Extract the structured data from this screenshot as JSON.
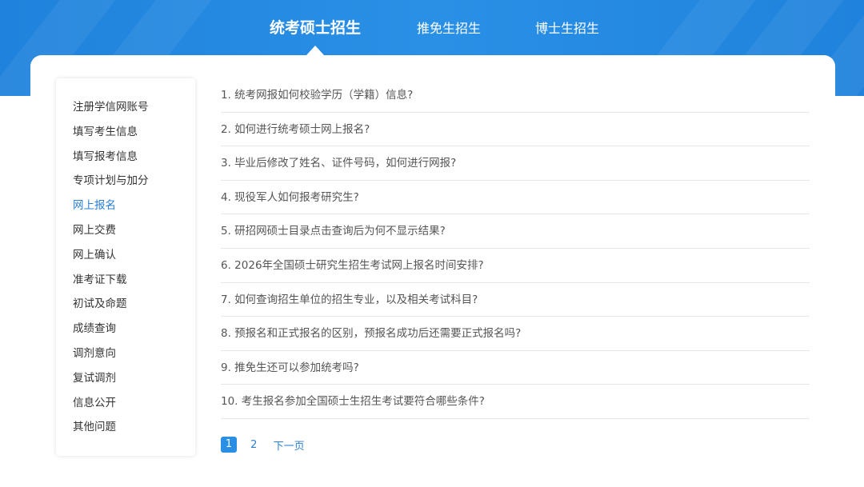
{
  "tabs": [
    {
      "label": "统考硕士招生",
      "active": true
    },
    {
      "label": "推免生招生",
      "active": false
    },
    {
      "label": "博士生招生",
      "active": false
    }
  ],
  "sidebar": {
    "items": [
      {
        "label": "注册学信网账号"
      },
      {
        "label": "填写考生信息"
      },
      {
        "label": "填写报考信息"
      },
      {
        "label": "专项计划与加分"
      },
      {
        "label": "网上报名",
        "active": true
      },
      {
        "label": "网上交费"
      },
      {
        "label": "网上确认"
      },
      {
        "label": "准考证下载"
      },
      {
        "label": "初试及命题"
      },
      {
        "label": "成绩查询"
      },
      {
        "label": "调剂意向"
      },
      {
        "label": "复试调剂"
      },
      {
        "label": "信息公开"
      },
      {
        "label": "其他问题"
      }
    ]
  },
  "faq": {
    "items": [
      "1. 统考网报如何校验学历（学籍）信息?",
      "2. 如何进行统考硕士网上报名?",
      "3. 毕业后修改了姓名、证件号码，如何进行网报?",
      "4. 现役军人如何报考研究生?",
      "5. 研招网硕士目录点击查询后为何不显示结果?",
      "6. 2026年全国硕士研究生招生考试网上报名时间安排?",
      "7. 如何查询招生单位的招生专业，以及相关考试科目?",
      "8. 预报名和正式报名的区别，预报名成功后还需要正式报名吗?",
      "9. 推免生还可以参加统考吗?",
      "10. 考生报名参加全国硕士生招生考试要符合哪些条件?"
    ]
  },
  "pagination": {
    "current": "1",
    "page2": "2",
    "next": "下一页"
  },
  "colors": {
    "banner": "#1f82dc",
    "accent": "#2a7fd4",
    "current_page_bg": "#2a8ee4"
  }
}
